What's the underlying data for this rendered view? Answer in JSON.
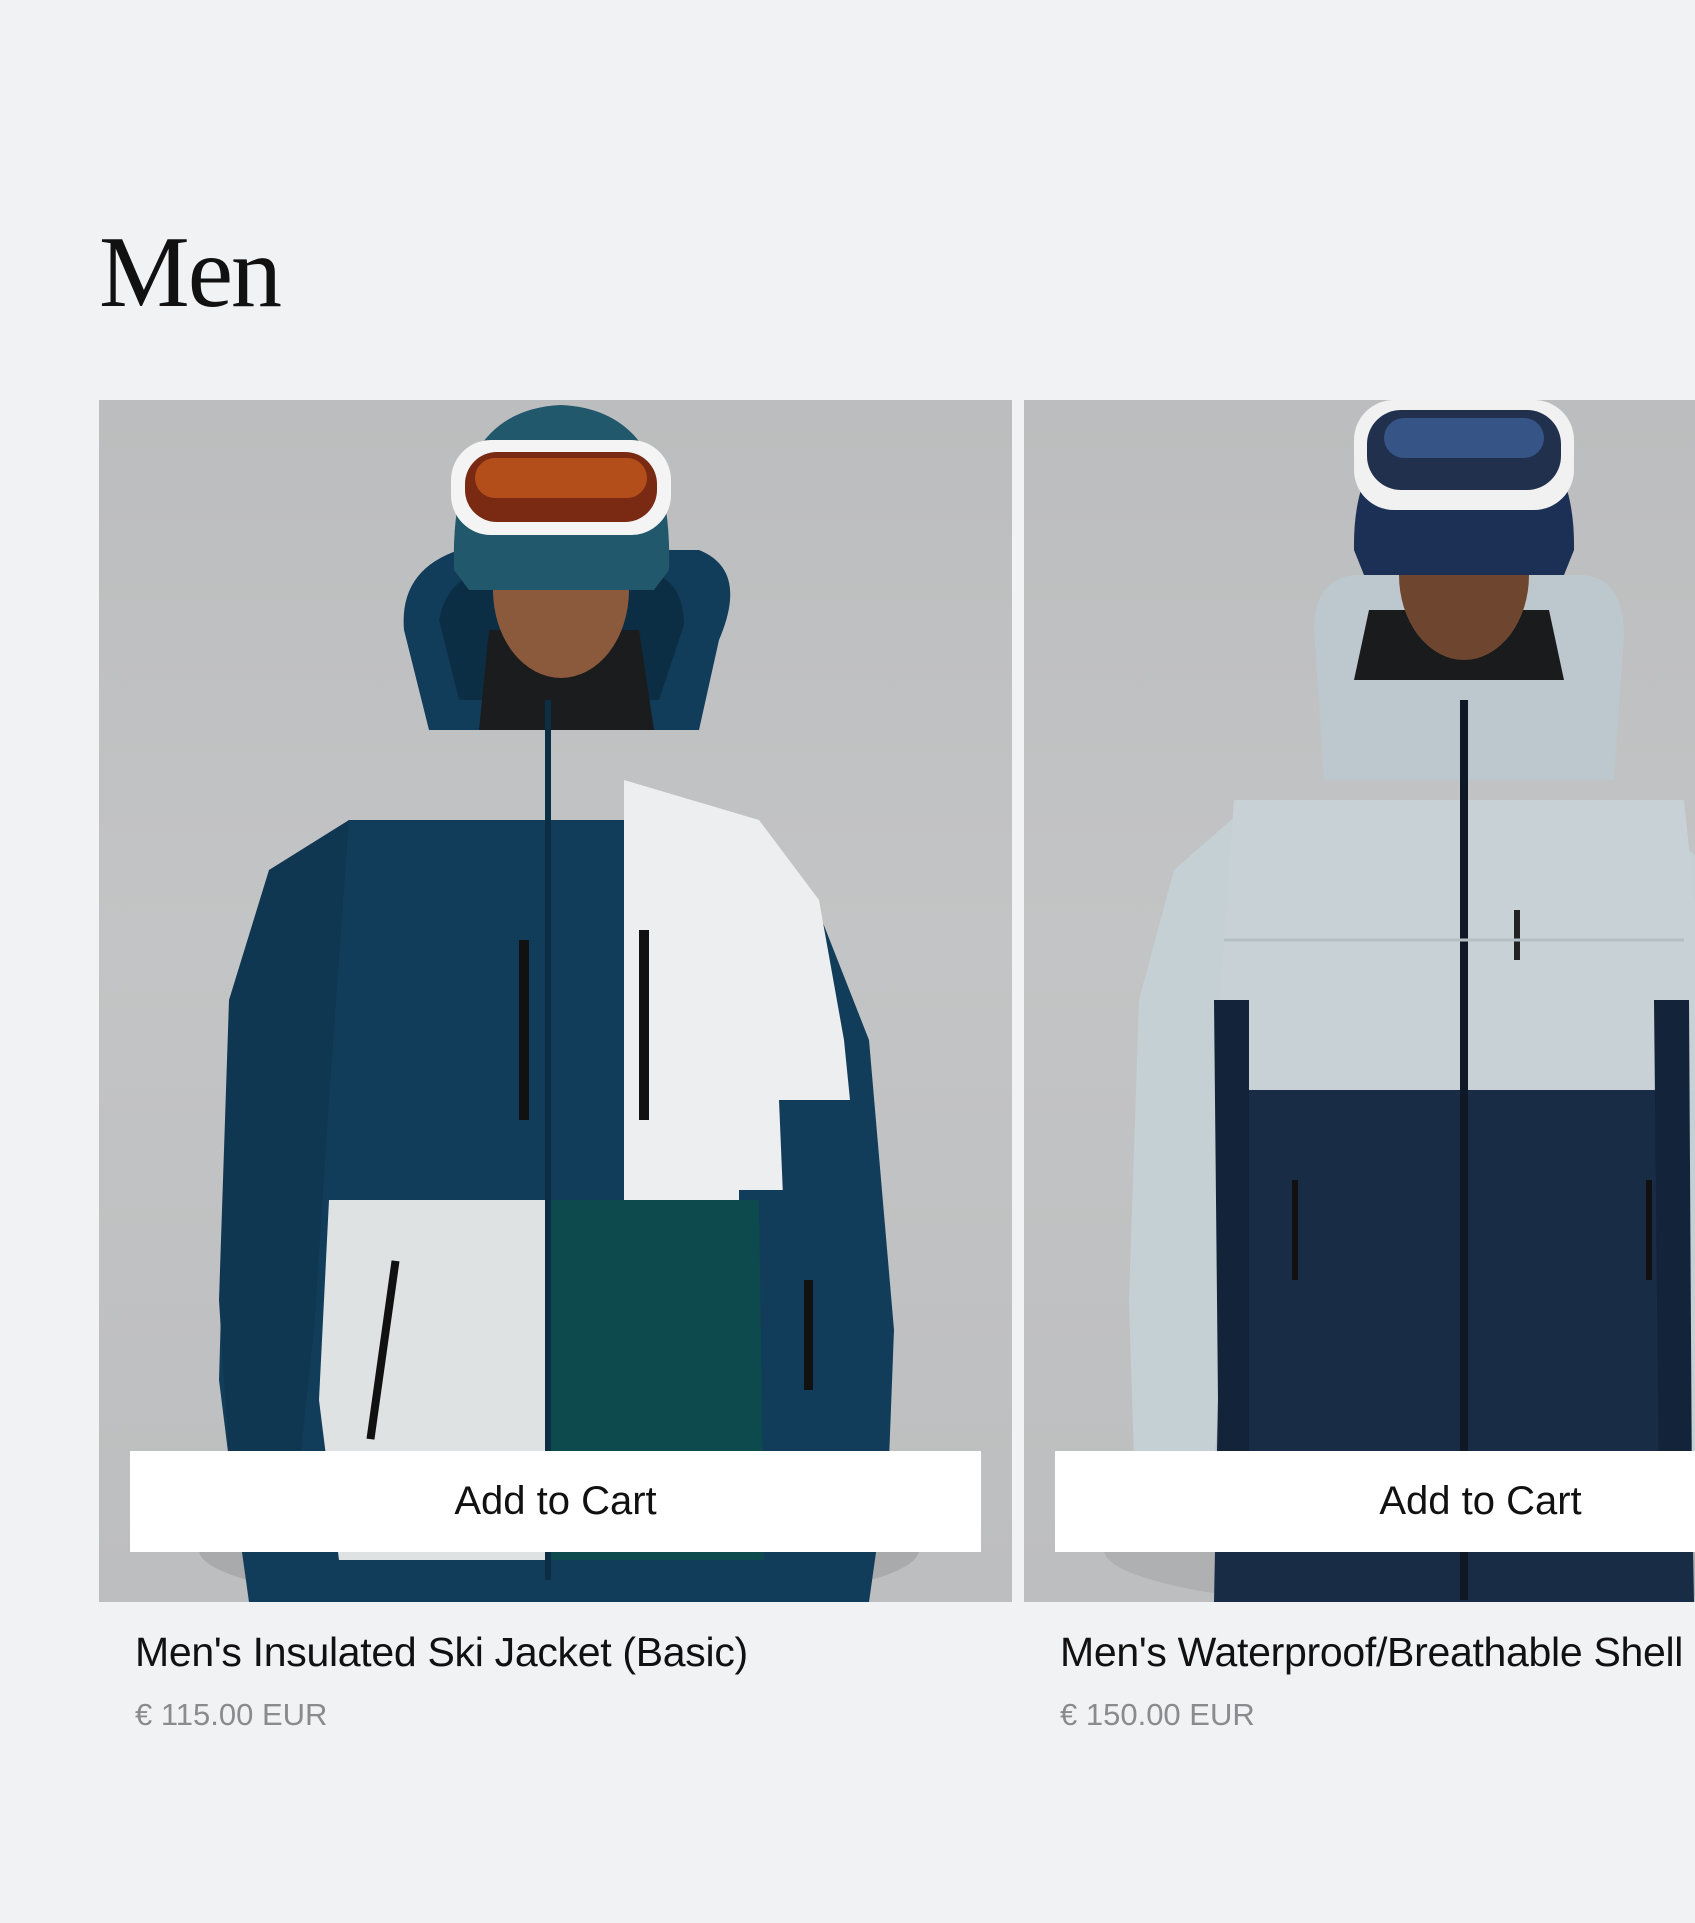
{
  "page": {
    "title": "Men"
  },
  "products": [
    {
      "name": "Men's Insulated Ski Jacket (Basic)",
      "price": "€ 115.00 EUR",
      "cta": "Add to Cart",
      "image_alt": "Model wearing navy, white and teal insulated ski jacket with goggles"
    },
    {
      "name": "Men's Waterproof/Breathable Shell",
      "price": "€ 150.00 EUR",
      "cta": "Add to Cart",
      "image_alt": "Model wearing light grey and navy waterproof shell jacket with goggles"
    }
  ],
  "colors": {
    "background": "#f1f2f4",
    "button_bg": "#ffffff",
    "price_text": "#8a8b8e",
    "title_text": "#111111"
  }
}
